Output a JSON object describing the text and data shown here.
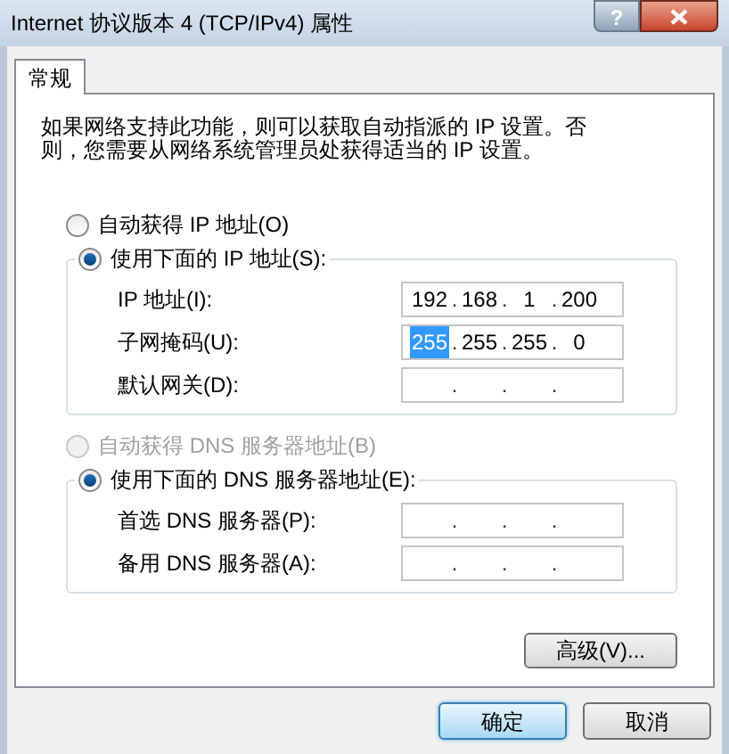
{
  "window": {
    "title": "Internet 协议版本 4 (TCP/IPv4) 属性",
    "help_button": "?"
  },
  "tabs": [
    {
      "label": "常规",
      "selected": true
    }
  ],
  "description": "如果网络支持此功能，则可以获取自动指派的 IP 设置。否则，您需要从网络系统管理员处获得适当的 IP 设置。",
  "ip_mode": [
    {
      "label": "自动获得 IP 地址(O)",
      "selected": false,
      "disabled": false
    },
    {
      "label": "使用下面的 IP 地址(S):",
      "selected": true,
      "disabled": false
    }
  ],
  "ip_fields": [
    {
      "label": "IP 地址(I):",
      "octets": [
        {
          "value": "192",
          "selected": false
        },
        {
          "value": "168",
          "selected": false
        },
        {
          "value": "1",
          "selected": false
        },
        {
          "value": "200",
          "selected": false
        }
      ],
      "separators": [
        ".",
        ".",
        "."
      ]
    },
    {
      "label": "子网掩码(U):",
      "octets": [
        {
          "value": "255",
          "selected": true
        },
        {
          "value": "255",
          "selected": false
        },
        {
          "value": "255",
          "selected": false
        },
        {
          "value": "0",
          "selected": false
        }
      ],
      "separators": [
        ".",
        ".",
        "."
      ]
    },
    {
      "label": "默认网关(D):",
      "separators": [
        ".",
        ".",
        "."
      ]
    }
  ],
  "dns_mode": [
    {
      "label": "自动获得 DNS 服务器地址(B)",
      "selected": false,
      "disabled": true
    },
    {
      "label": "使用下面的 DNS 服务器地址(E):",
      "selected": true,
      "disabled": false
    }
  ],
  "dns_fields": [
    {
      "label": "首选 DNS 服务器(P):",
      "separators": [
        ".",
        ".",
        "."
      ]
    },
    {
      "label": "备用 DNS 服务器(A):",
      "separators": [
        ".",
        ".",
        "."
      ]
    }
  ],
  "advanced_button": "高级(V)...",
  "buttons": [
    {
      "label": "确定",
      "default": true
    },
    {
      "label": "取消",
      "default": false
    }
  ]
}
